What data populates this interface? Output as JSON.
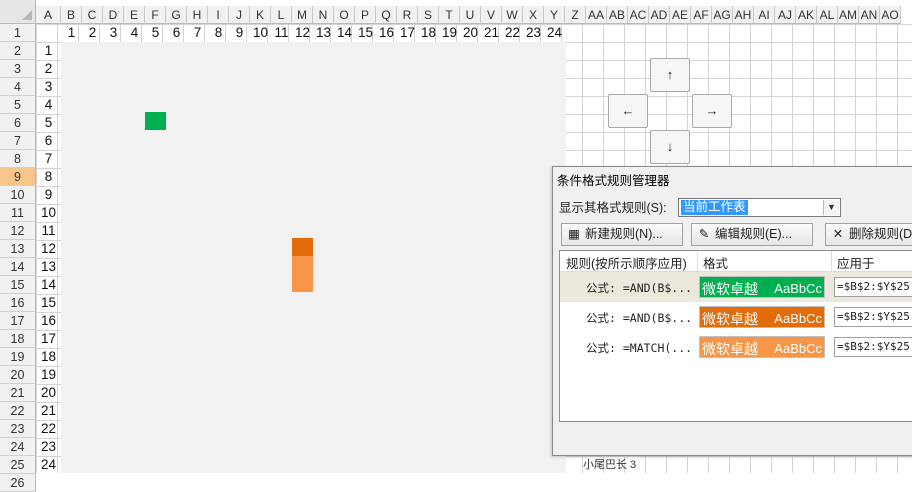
{
  "sheet": {
    "column_headers": [
      "A",
      "B",
      "C",
      "D",
      "E",
      "F",
      "G",
      "H",
      "I",
      "J",
      "K",
      "L",
      "M",
      "N",
      "O",
      "P",
      "Q",
      "R",
      "S",
      "T",
      "U",
      "V",
      "W",
      "X",
      "Y",
      "Z",
      "AA",
      "AB",
      "AC",
      "AD",
      "AE",
      "AF",
      "AG",
      "AH",
      "AI",
      "AJ",
      "AK",
      "AL",
      "AM",
      "AN",
      "AO"
    ],
    "row_headers": [
      "1",
      "2",
      "3",
      "4",
      "5",
      "6",
      "7",
      "8",
      "9",
      "10",
      "11",
      "12",
      "13",
      "14",
      "15",
      "16",
      "17",
      "18",
      "19",
      "20",
      "21",
      "22",
      "23",
      "24",
      "25",
      "26"
    ],
    "selected_row": "9",
    "top_numbers": [
      "1",
      "2",
      "3",
      "4",
      "5",
      "6",
      "7",
      "8",
      "9",
      "10",
      "11",
      "12",
      "13",
      "14",
      "15",
      "16",
      "17",
      "18",
      "19",
      "20",
      "21",
      "22",
      "23",
      "24"
    ],
    "left_numbers": [
      "1",
      "2",
      "3",
      "4",
      "5",
      "6",
      "7",
      "8",
      "9",
      "10",
      "11",
      "12",
      "13",
      "14",
      "15",
      "16",
      "17",
      "18",
      "19",
      "20",
      "21",
      "22",
      "23",
      "24"
    ],
    "colors": {
      "green": "#00b050",
      "dark_orange": "#e26b0a",
      "light_orange": "#f79646",
      "playfield": "#f2f2f2"
    }
  },
  "arrow_keys": {
    "up": "↑",
    "left": "←",
    "right": "→",
    "down": "↓"
  },
  "status_bar": {
    "text": "小尾巴长 3"
  },
  "dialog": {
    "title": "条件格式规则管理器",
    "show_rules_label": "显示其格式规则(S):",
    "scope_value": "当前工作表",
    "buttons": {
      "new_rule": "新建规则(N)...",
      "edit_rule": "编辑规则(E)...",
      "delete_rule": "删除规则(D)"
    },
    "columns": {
      "rule": "规则(按所示顺序应用)",
      "format": "格式",
      "applies_to": "应用于"
    },
    "rules": [
      {
        "rule": "公式: =AND(B$...",
        "format_text": "微软卓越",
        "format_sample": "AaBbCc",
        "applies_to": "=$B$2:$Y$25",
        "color": "#00b050"
      },
      {
        "rule": "公式: =AND(B$...",
        "format_text": "微软卓越",
        "format_sample": "AaBbCc",
        "applies_to": "=$B$2:$Y$25",
        "color": "#e26b0a"
      },
      {
        "rule": "公式: =MATCH(...",
        "format_text": "微软卓越",
        "format_sample": "AaBbCc",
        "applies_to": "=$B$2:$Y$25",
        "color": "#f79646"
      }
    ]
  }
}
